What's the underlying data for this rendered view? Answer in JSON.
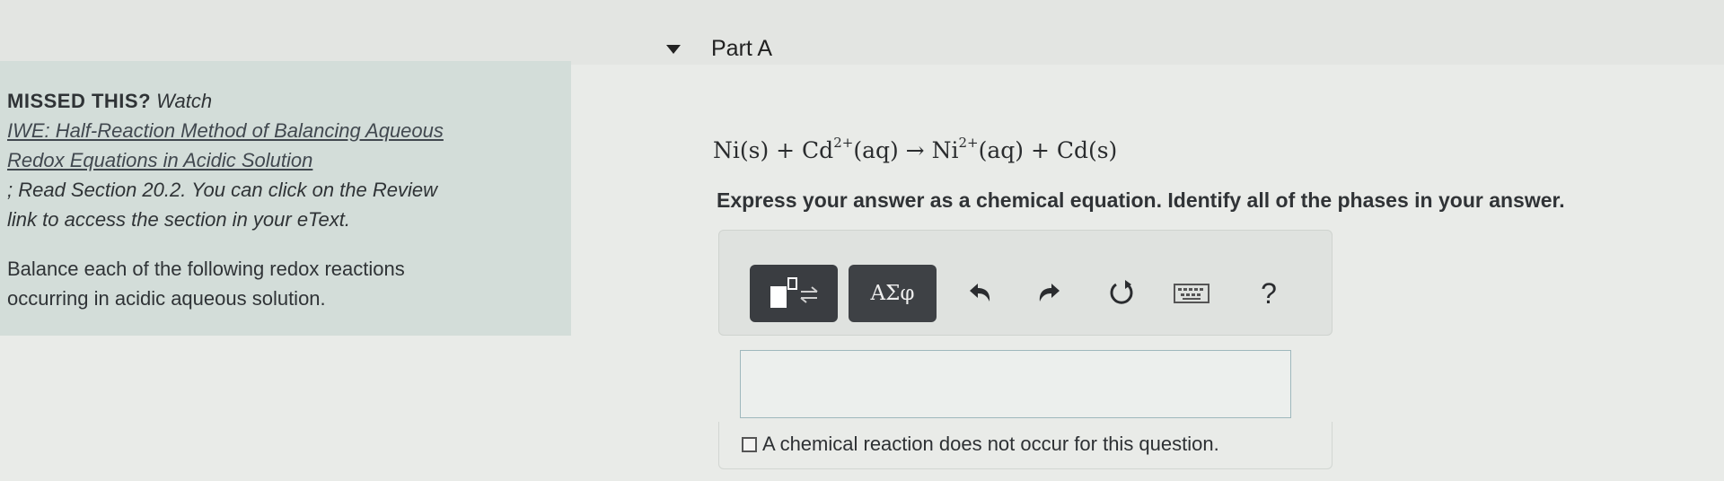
{
  "sidebar": {
    "missed_label": "MISSED THIS?",
    "watch_label": "Watch",
    "video_link_line1": "IWE: Half-Reaction Method of Balancing Aqueous",
    "video_link_line2": "Redox Equations in Acidic Solution",
    "read_line1": "; Read Section 20.2. You can click on the Review",
    "read_line2": "link to access the section in your eText.",
    "prompt_line1": "Balance each of the following redox reactions",
    "prompt_line2": "occurring in acidic aqueous solution."
  },
  "part": {
    "title": "Part A",
    "equation": {
      "reactant1": "Ni(s) + Cd",
      "reactant1_sup": "2+",
      "reactant1_tail": "(aq) → Ni",
      "product1_sup": "2+",
      "product_tail": "(aq) + Cd(s)"
    },
    "instructions": "Express your answer as a chemical equation. Identify all of the phases in your answer."
  },
  "toolbar": {
    "greek_label": "ΑΣφ",
    "help_label": "?",
    "icons": [
      "templates-icon",
      "greek-symbols-icon",
      "undo-icon",
      "redo-icon",
      "reset-icon",
      "keyboard-icon",
      "help-icon"
    ]
  },
  "answer": {
    "value": "",
    "no_reaction_label": "A chemical reaction does not occur for this question."
  },
  "colors": {
    "sidebar_bg": "#d3ddd9",
    "page_bg": "#e9ebe8",
    "dark_button": "#3a3d41"
  }
}
